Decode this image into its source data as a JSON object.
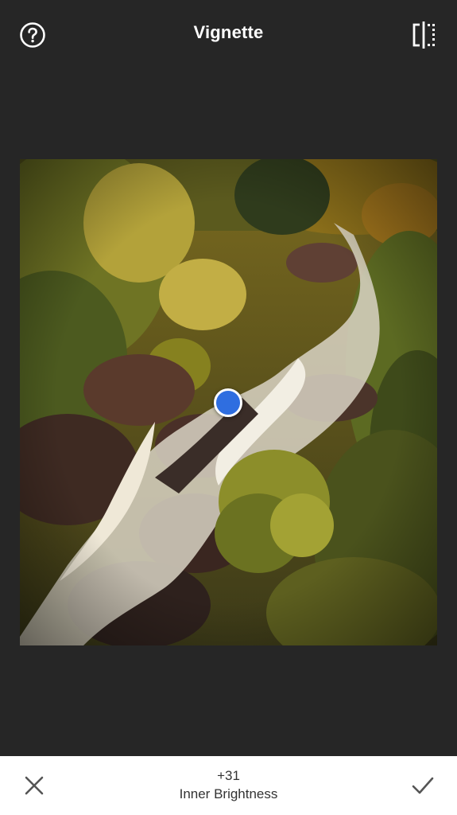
{
  "header": {
    "title": "Vignette",
    "help_icon": "help-circle-icon",
    "compare_icon": "compare-split-icon"
  },
  "photo": {
    "subject": "waterfall river through autumn forest"
  },
  "adjustment": {
    "value": "+31",
    "parameter": "Inner Brightness"
  },
  "footer": {
    "cancel_icon": "close-icon",
    "apply_icon": "checkmark-icon"
  },
  "colors": {
    "background": "#262626",
    "handle": "#2f6ee0",
    "bottom_bar": "#ffffff",
    "bottom_text": "#333333"
  }
}
